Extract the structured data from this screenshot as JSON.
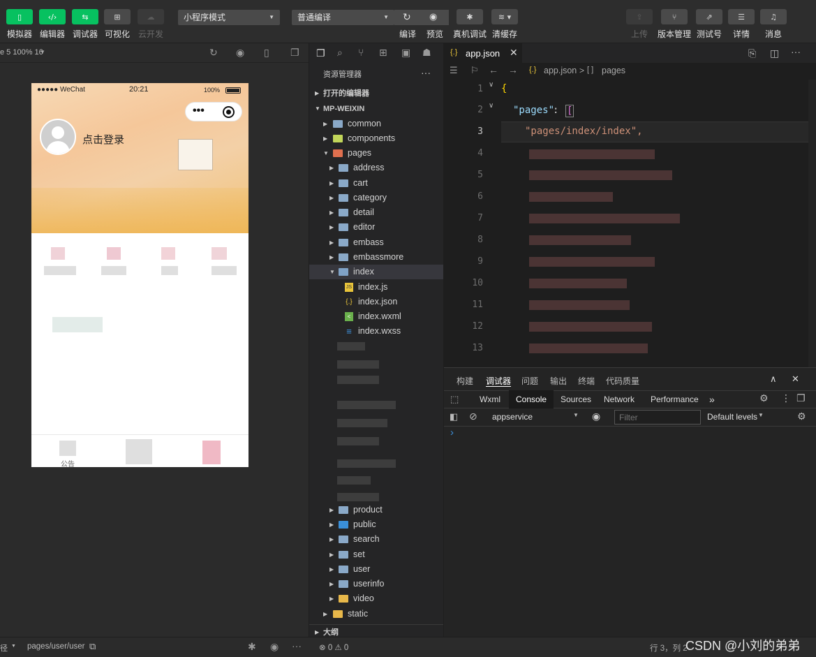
{
  "toolbar": {
    "buttons": [
      {
        "label": "模拟器"
      },
      {
        "label": "编辑器"
      },
      {
        "label": "调试器"
      },
      {
        "label": "可视化"
      },
      {
        "label": "云开发"
      }
    ],
    "mode_select": "小程序模式",
    "compile_select": "普通编译",
    "actions": [
      {
        "label": "编译"
      },
      {
        "label": "预览"
      },
      {
        "label": "真机调试"
      },
      {
        "label": "清缓存"
      }
    ],
    "right_buttons": [
      {
        "label": "上传"
      },
      {
        "label": "版本管理"
      },
      {
        "label": "测试号"
      },
      {
        "label": "详情"
      },
      {
        "label": "消息"
      }
    ]
  },
  "simulator": {
    "device": "e 5 100% 16",
    "status_carrier": "●●●●● WeChat",
    "status_time": "20:21",
    "status_battery": "100%",
    "capsule_dots": "•••",
    "login_text": "点击登录",
    "tab_label": "公告"
  },
  "explorer": {
    "title": "资源管理器",
    "more": "···",
    "open_editors": "打开的编辑器",
    "project": "MP-WEIXIN",
    "items": [
      {
        "name": "common"
      },
      {
        "name": "components"
      },
      {
        "name": "pages"
      },
      {
        "name": "address"
      },
      {
        "name": "cart"
      },
      {
        "name": "category"
      },
      {
        "name": "detail"
      },
      {
        "name": "editor"
      },
      {
        "name": "embass"
      },
      {
        "name": "embassmore"
      },
      {
        "name": "index"
      },
      {
        "name": "index.js"
      },
      {
        "name": "index.json"
      },
      {
        "name": "index.wxml"
      },
      {
        "name": "index.wxss"
      }
    ],
    "items_lower": [
      {
        "name": "product"
      },
      {
        "name": "public"
      },
      {
        "name": "search"
      },
      {
        "name": "set"
      },
      {
        "name": "user"
      },
      {
        "name": "userinfo"
      },
      {
        "name": "video"
      },
      {
        "name": "static"
      }
    ],
    "outline": "大纲"
  },
  "editor": {
    "tab_icon": "{.}",
    "tab_name": "app.json",
    "breadcrumb_file": "app.json",
    "breadcrumb_sep": ">",
    "breadcrumb_arr": "[ ]",
    "breadcrumb_node": "pages",
    "line_numbers": [
      "1",
      "2",
      "3",
      "4",
      "5",
      "6",
      "7",
      "8",
      "9",
      "10",
      "11",
      "12",
      "13"
    ],
    "line1": "{",
    "line2_key": "\"pages\"",
    "line2_colon": ":",
    "line2_bracket": "[",
    "line3": "\"pages/index/index\",",
    "line3_comma": ","
  },
  "debugger": {
    "tabs": [
      {
        "label": "构建"
      },
      {
        "label": "调试器"
      },
      {
        "label": "问题"
      },
      {
        "label": "输出"
      },
      {
        "label": "终端"
      },
      {
        "label": "代码质量"
      }
    ],
    "panel_tabs": [
      {
        "label": "Wxml"
      },
      {
        "label": "Console"
      },
      {
        "label": "Sources"
      },
      {
        "label": "Network"
      },
      {
        "label": "Performance"
      }
    ],
    "more_tabs": "»",
    "context": "appservice",
    "filter_placeholder": "Filter",
    "levels": "Default levels",
    "prompt": "›"
  },
  "status": {
    "left_prefix": "径",
    "page_path": "pages/user/user",
    "errors": "⊗ 0 ⚠ 0",
    "position": "行 3，列 2",
    "watermark": "CSDN @小刘的弟弟"
  },
  "colors": {
    "accent_green": "#07c160",
    "code_key": "#9cdcfe",
    "code_string": "#ce9178",
    "code_brace": "#ffd700"
  }
}
